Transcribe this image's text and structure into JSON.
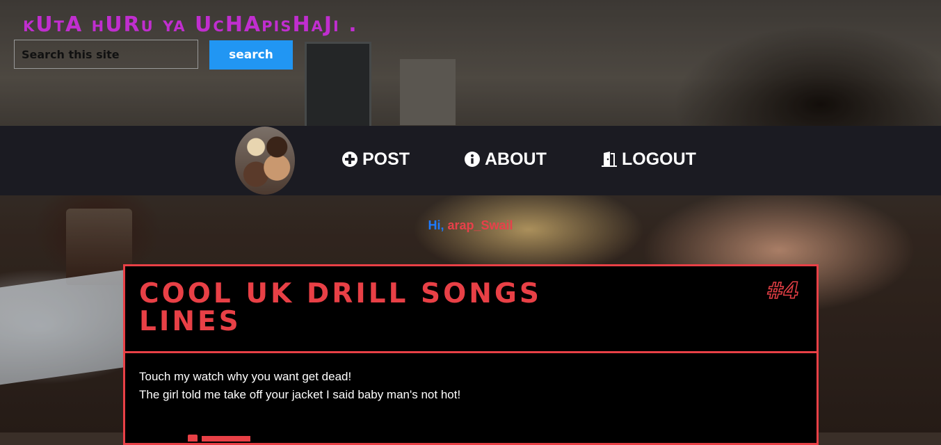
{
  "header": {
    "site_title": "kUtA hURu ya UcHApisHaJi .",
    "search": {
      "placeholder": "Search this site",
      "value": "",
      "button_label": "search"
    }
  },
  "nav": {
    "items": [
      {
        "label": "POST",
        "icon": "plus-circle-icon"
      },
      {
        "label": "ABOUT",
        "icon": "info-circle-icon"
      },
      {
        "label": "LOGOUT",
        "icon": "door-open-icon"
      }
    ]
  },
  "greeting": {
    "hi": "Hi,",
    "username": "arap_Swail"
  },
  "post": {
    "title": "COOL UK DRILL SONGS LINES",
    "number": "#4",
    "lines": [
      "Touch my watch why you want get dead!",
      "The girl told me take off your jacket I said baby man's not hot!"
    ]
  },
  "colors": {
    "accent": "#e84046",
    "title_purple": "#c02ecf",
    "search_blue": "#2196f3",
    "nav_bg": "#1b1b22",
    "greeting_blue": "#1e7bff"
  }
}
